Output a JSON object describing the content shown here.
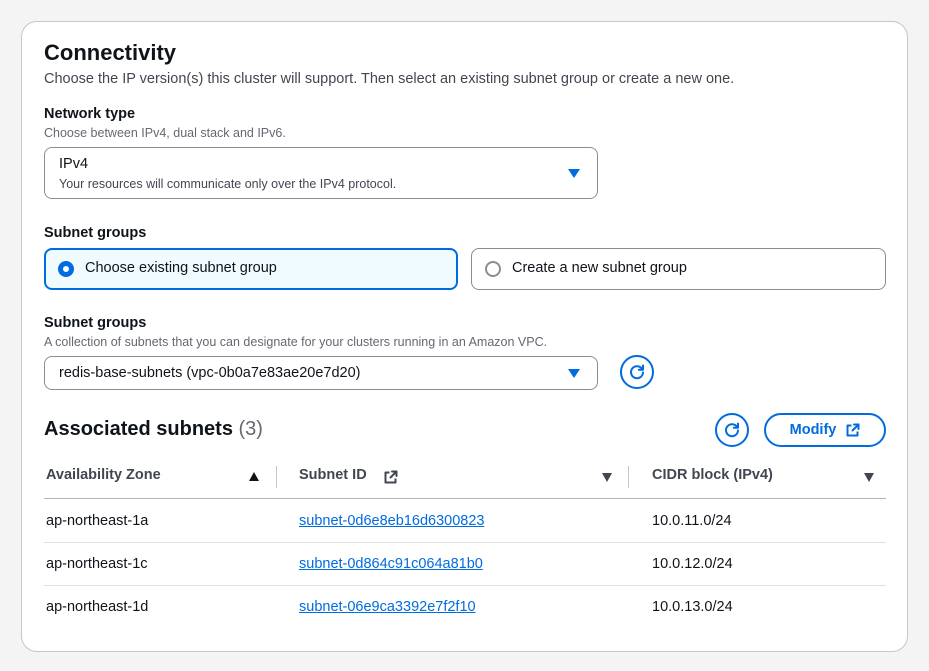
{
  "section": {
    "title": "Connectivity",
    "description": "Choose the IP version(s) this cluster will support. Then select an existing subnet group or create a new one."
  },
  "network_type": {
    "label": "Network type",
    "description": "Choose between IPv4, dual stack and IPv6.",
    "selected_value": "IPv4",
    "selected_description": "Your resources will communicate only over the IPv4 protocol."
  },
  "subnet_group_choice": {
    "label": "Subnet groups",
    "options": [
      {
        "label": "Choose existing subnet group",
        "selected": true
      },
      {
        "label": "Create a new subnet group",
        "selected": false
      }
    ]
  },
  "subnet_group_select": {
    "label": "Subnet groups",
    "description": "A collection of subnets that you can designate for your clusters running in an Amazon VPC.",
    "selected_value": "redis-base-subnets (vpc-0b0a7e83ae20e7d20)"
  },
  "associated_subnets": {
    "title": "Associated subnets",
    "count": "(3)",
    "modify_label": "Modify",
    "columns": [
      "Availability Zone",
      "Subnet ID",
      "CIDR block (IPv4)"
    ],
    "rows": [
      {
        "az": "ap-northeast-1a",
        "subnet_id": "subnet-0d6e8eb16d6300823",
        "cidr": "10.0.11.0/24"
      },
      {
        "az": "ap-northeast-1c",
        "subnet_id": "subnet-0d864c91c064a81b0",
        "cidr": "10.0.12.0/24"
      },
      {
        "az": "ap-northeast-1d",
        "subnet_id": "subnet-06e9ca3392e7f2f10",
        "cidr": "10.0.13.0/24"
      }
    ]
  },
  "colors": {
    "accent": "#006ce0",
    "selected_tile_bg": "#f0fbff",
    "border": "#8c8c94",
    "text": "#0f141a",
    "secondary_text": "#424650"
  },
  "icons": [
    "caret-down-icon",
    "refresh-icon",
    "external-link-icon",
    "sort-ascending-icon",
    "sort-descending-icon"
  ]
}
